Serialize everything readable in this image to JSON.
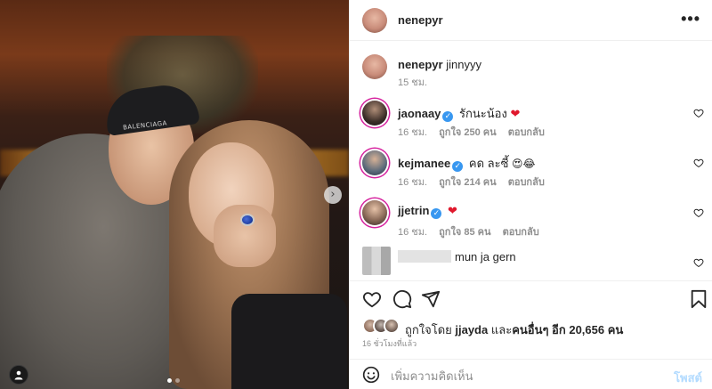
{
  "photo": {
    "cap_text": "BALENCIAGA",
    "next_icon": "chevron-right-icon",
    "tag_icon": "user-tag-icon",
    "carousel_pages": 2,
    "carousel_active": 1
  },
  "header": {
    "username": "nenepyr",
    "more_label": "•••"
  },
  "caption": {
    "username": "nenepyr",
    "text": "jinnyyy",
    "time": "15 ชม."
  },
  "comments": [
    {
      "username": "jaonaay",
      "verified": true,
      "text": "รักนะน้อง",
      "emoji": "❤",
      "time": "16 ชม.",
      "likes": "ถูกใจ 250 คน",
      "reply": "ตอบกลับ"
    },
    {
      "username": "kejmanee",
      "verified": true,
      "text": "คด ละซี้",
      "emoji": "😍😂",
      "time": "16 ชม.",
      "likes": "ถูกใจ 214 คน",
      "reply": "ตอบกลับ"
    },
    {
      "username": "jjetrin",
      "verified": true,
      "text": "",
      "emoji": "❤",
      "time": "16 ชม.",
      "likes": "ถูกใจ 85 คน",
      "reply": "ตอบกลับ"
    },
    {
      "username": "",
      "verified": false,
      "text": "mun ja gern",
      "emoji": "",
      "time": "",
      "likes": "",
      "reply": ""
    }
  ],
  "likes": {
    "prefix": "ถูกใจโดย",
    "user": "jjayda",
    "middle": "และ",
    "others": "คนอื่นๆ อีก 20,656 คน"
  },
  "time_ago": "16 ชั่วโมงที่แล้ว",
  "add_comment": {
    "placeholder": "เพิ่มความคิดเห็น",
    "post_label": "โพสต์"
  },
  "colors": {
    "verified": "#3897f0",
    "heart_red": "#e0182d",
    "post_disabled": "#b3dbff",
    "story_ring": "#d6249f"
  }
}
